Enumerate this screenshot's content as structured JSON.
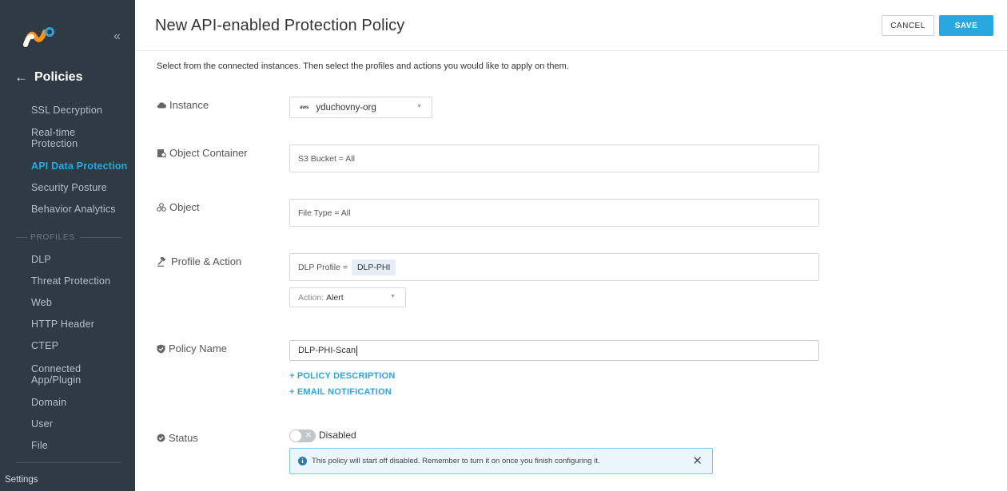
{
  "sidebar": {
    "back_label": "Policies",
    "items": [
      {
        "label": "SSL Decryption",
        "active": false
      },
      {
        "label": "Real-time\nProtection",
        "active": false
      },
      {
        "label": "API Data Protection",
        "active": true
      },
      {
        "label": "Security Posture",
        "active": false
      },
      {
        "label": "Behavior Analytics",
        "active": false
      }
    ],
    "profiles_section": "PROFILES",
    "profile_items": [
      {
        "label": "DLP"
      },
      {
        "label": "Threat Protection"
      },
      {
        "label": "Web"
      },
      {
        "label": "HTTP Header"
      },
      {
        "label": "CTEP"
      },
      {
        "label": "Connected\nApp/Plugin"
      },
      {
        "label": "Domain"
      },
      {
        "label": "User"
      },
      {
        "label": "File"
      }
    ],
    "settings_label": "Settings"
  },
  "header": {
    "title": "New API-enabled Protection Policy",
    "cancel_label": "CANCEL",
    "save_label": "SAVE"
  },
  "intro": "Select from the connected instances. Then select the profiles and actions you would like to apply on them.",
  "form": {
    "instance": {
      "label": "Instance",
      "provider_badge": "aws",
      "value": "yduchovny-org"
    },
    "object_container": {
      "label": "Object Container",
      "value": "S3 Bucket = All"
    },
    "object": {
      "label": "Object",
      "value": "File Type = All"
    },
    "profile_action": {
      "label": "Profile & Action",
      "profile_prefix": "DLP Profile =",
      "profile_chip": "DLP-PHI",
      "action_prefix": "Action:",
      "action_value": "Alert"
    },
    "policy_name": {
      "label": "Policy Name",
      "value": "DLP-PHI-Scan",
      "add_description": "+ POLICY DESCRIPTION",
      "add_email": "+ EMAIL NOTIFICATION"
    },
    "status": {
      "label": "Status",
      "value": "Disabled",
      "alert": "This policy will start off disabled. Remember to turn it on once you finish configuring it."
    }
  },
  "colors": {
    "sidebar_bg": "#2f3a44",
    "accent": "#29a8e0",
    "alert_bg": "#eaf6fc"
  }
}
